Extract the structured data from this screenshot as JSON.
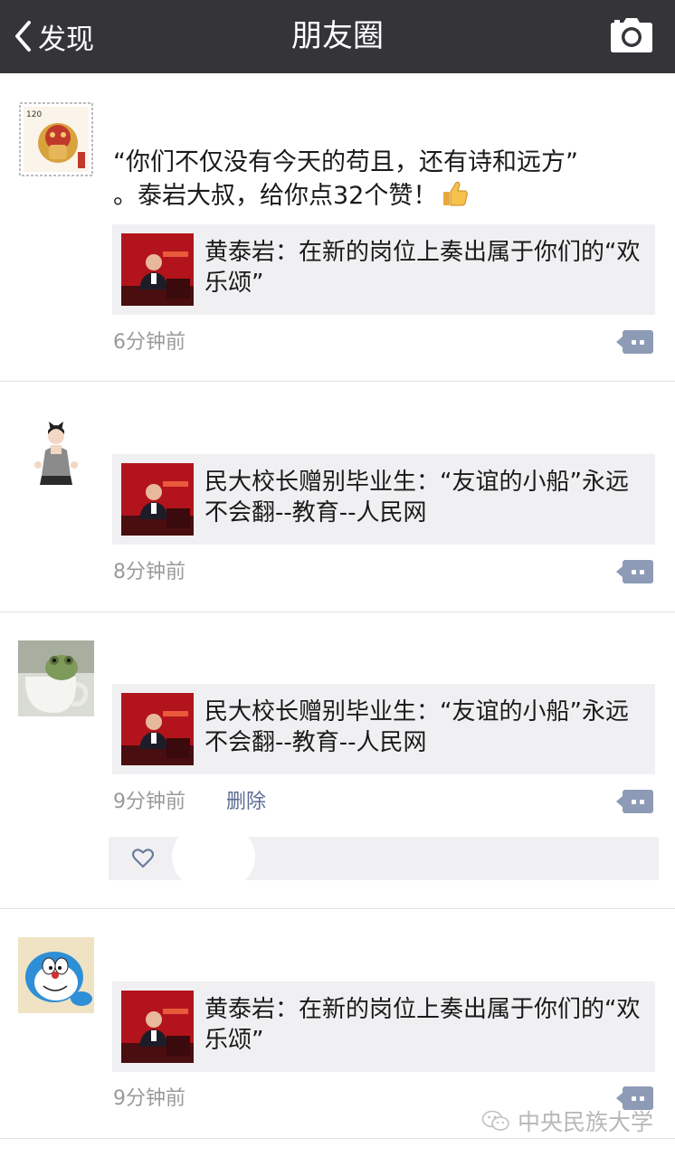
{
  "navbar": {
    "back_label": "发现",
    "title": "朋友圈",
    "icons": {
      "back": "chevron-left-icon",
      "camera": "camera-icon"
    }
  },
  "posts": [
    {
      "text": "“你们不仅没有今天的苟且，还有诗和远方”\n。泰岩大叔，给你点32个赞！",
      "emoji": "thumbs-up-icon",
      "link_title": "黄泰岩：在新的岗位上奏出属于你们的“欢乐颂”",
      "time": "6分钟前"
    },
    {
      "link_title": "民大校长赠别毕业生：“友谊的小船”永远不会翻--教育--人民网",
      "time": "8分钟前"
    },
    {
      "link_title": "民大校长赠别毕业生：“友谊的小船”永远不会翻--教育--人民网",
      "time": "9分钟前",
      "delete_label": "删除",
      "likes_icon": "heart-outline-icon"
    },
    {
      "link_title": "黄泰岩：在新的岗位上奏出属于你们的“欢乐颂”",
      "time": "9分钟前"
    }
  ],
  "watermark": {
    "text": "中央民族大学",
    "icon": "wechat-icon"
  },
  "colors": {
    "navbar_bg": "#353539",
    "card_bg": "#f0f0f2",
    "link_blue": "#5b6c93",
    "comment_btn": "#8d9bb6",
    "time_gray": "#9a9a9a"
  }
}
